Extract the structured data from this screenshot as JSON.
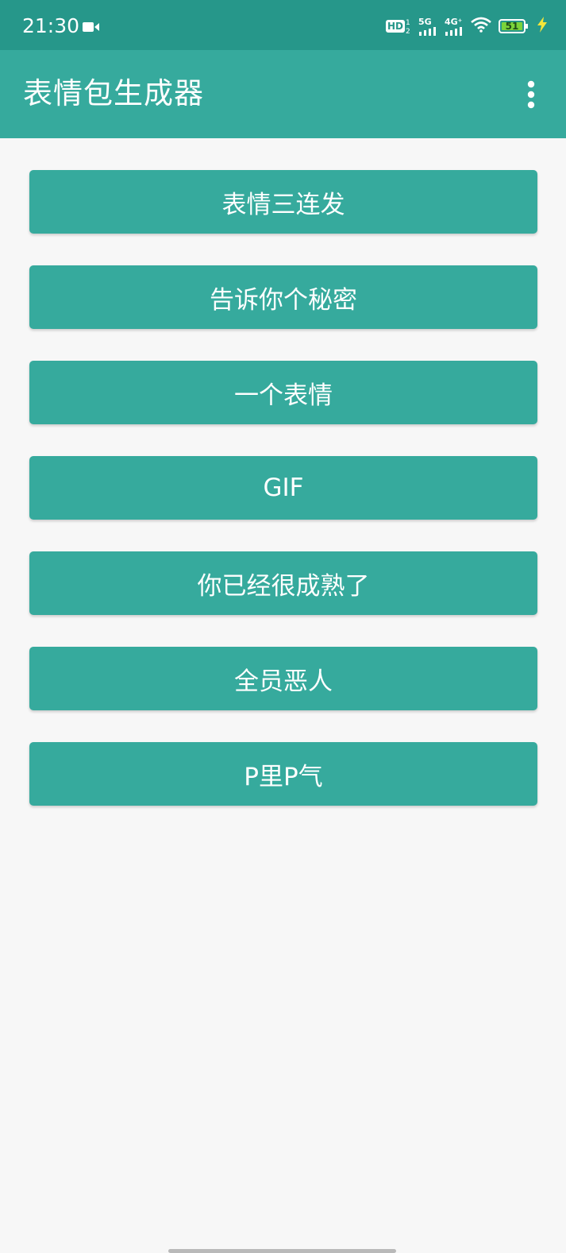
{
  "status_bar": {
    "time": "21:30",
    "battery_level": "51",
    "network_5g": "5G",
    "network_4g": "4G⁺",
    "hd_label": "HD",
    "icons": [
      "video-camera-icon",
      "hd-icon",
      "signal-5g-icon",
      "signal-4g-icon",
      "wifi-icon",
      "battery-icon",
      "charging-bolt-icon"
    ]
  },
  "app_bar": {
    "title": "表情包生成器",
    "menu_icon": "more-vert-icon"
  },
  "buttons": [
    {
      "label": "表情三连发"
    },
    {
      "label": "告诉你个秘密"
    },
    {
      "label": "一个表情"
    },
    {
      "label": "GIF"
    },
    {
      "label": "你已经很成熟了"
    },
    {
      "label": "全员恶人"
    },
    {
      "label": "P里P气"
    }
  ],
  "colors": {
    "status_bar": "#26978a",
    "primary": "#36aa9d",
    "background": "#f7f7f7",
    "text_on_primary": "#ffffff",
    "battery": "#7bd43a"
  }
}
